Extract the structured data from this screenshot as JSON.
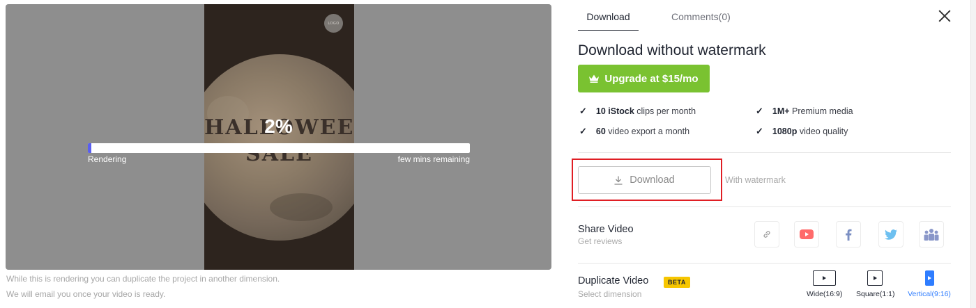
{
  "preview": {
    "progress_percent": "2%",
    "progress_value": 0.01,
    "status_left": "Rendering",
    "status_right": "few mins remaining",
    "video_logo": "LOGO",
    "video_title_line1": "HALLOWEEN",
    "video_title_line2": "SALE",
    "note_line1": "While this is rendering you can duplicate the project in another dimension.",
    "note_line2": "We will email you once your video is ready."
  },
  "tabs": [
    {
      "label": "Download",
      "active": true
    },
    {
      "label": "Comments(0)",
      "active": false
    }
  ],
  "panel": {
    "heading": "Download without watermark",
    "upgrade_label": "Upgrade at $15/mo",
    "features": [
      {
        "bold": "10 iStock",
        "rest": " clips per month"
      },
      {
        "bold": "1M+",
        "rest": " Premium media"
      },
      {
        "bold": "60",
        "rest": " video export a month"
      },
      {
        "bold": "1080p",
        "rest": " video quality"
      }
    ],
    "download_label": "Download",
    "with_watermark": "With watermark",
    "share_title": "Share Video",
    "share_sub": "Get reviews",
    "duplicate_title": "Duplicate Video",
    "duplicate_sub": "Select dimension",
    "beta_label": "BETA",
    "dimensions": [
      {
        "label": "Wide(16:9)",
        "selected": false
      },
      {
        "label": "Square(1:1)",
        "selected": false
      },
      {
        "label": "Vertical(9:16)",
        "selected": true
      }
    ]
  },
  "share_icons": [
    "link-icon",
    "youtube-icon",
    "facebook-icon",
    "twitter-icon",
    "group-icon"
  ],
  "colors": {
    "accent_green": "#7ac231",
    "highlight_red": "#e01e24",
    "selected_blue": "#2f7dff",
    "beta_yellow": "#f7c600",
    "youtube": "#ff5a5a",
    "facebook": "#3b5998",
    "twitter": "#1da1f2",
    "group": "#6b7bb7"
  }
}
